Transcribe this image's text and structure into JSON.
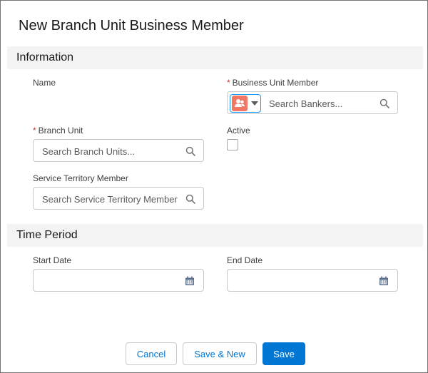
{
  "modal": {
    "title": "New Branch Unit Business Member"
  },
  "sections": {
    "information": "Information",
    "time_period": "Time Period"
  },
  "fields": {
    "name_label": "Name",
    "business_unit_member": {
      "required": "*",
      "label": "Business Unit Member",
      "placeholder": "Search Bankers...",
      "object_icon": "user-group-icon"
    },
    "branch_unit": {
      "required": "*",
      "label": "Branch Unit",
      "placeholder": "Search Branch Units..."
    },
    "active": {
      "label": "Active",
      "checked": false
    },
    "service_territory_member": {
      "label": "Service Territory Member",
      "placeholder": "Search Service Territory Member"
    },
    "start_date": {
      "label": "Start Date",
      "value": ""
    },
    "end_date": {
      "label": "End Date",
      "value": ""
    }
  },
  "footer": {
    "cancel": "Cancel",
    "save_new": "Save & New",
    "save": "Save"
  },
  "colors": {
    "brand": "#0176d3",
    "required": "#c23934",
    "object_icon_bg": "#f27764",
    "section_bg": "#f3f3f3"
  }
}
